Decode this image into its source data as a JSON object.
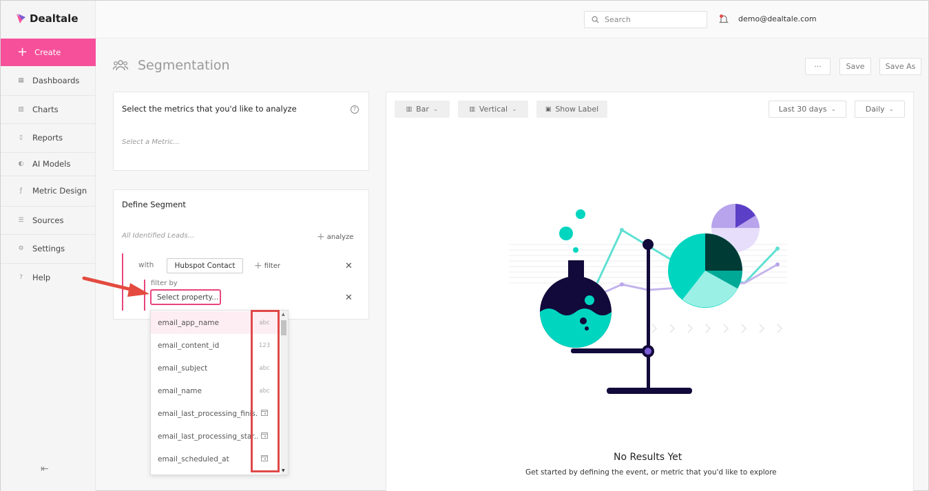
{
  "app": {
    "name": "Dealtale"
  },
  "sidebar": {
    "create_label": "Create",
    "items": [
      {
        "label": "Dashboards",
        "icon": "grid-icon"
      },
      {
        "label": "Charts",
        "icon": "bar-chart-icon"
      },
      {
        "label": "Reports",
        "icon": "document-icon"
      },
      {
        "label": "AI Models",
        "icon": "brain-icon"
      },
      {
        "label": "Metric Design",
        "icon": "function-icon"
      },
      {
        "label": "Sources",
        "icon": "database-icon"
      },
      {
        "label": "Settings",
        "icon": "gear-icon"
      },
      {
        "label": "Help",
        "icon": "question-icon"
      }
    ]
  },
  "topbar": {
    "search_placeholder": "Search",
    "user_email": "demo@dealtale.com"
  },
  "page": {
    "title": "Segmentation",
    "more_label": "···",
    "save_label": "Save",
    "save_as_label": "Save As"
  },
  "metrics_panel": {
    "title": "Select the metrics that you'd like to analyze",
    "placeholder": "Select a Metric..."
  },
  "segment_panel": {
    "title": "Define Segment",
    "leads_label": "All Identified Leads...",
    "analyze_label": "analyze",
    "with_label": "with",
    "contact_button": "Hubspot Contact",
    "filter_label": "filter",
    "filter_by_label": "filter by",
    "select_property": "Select property..."
  },
  "property_dropdown": [
    {
      "name": "email_app_name",
      "type": "abc"
    },
    {
      "name": "email_content_id",
      "type": "123"
    },
    {
      "name": "email_subject",
      "type": "abc"
    },
    {
      "name": "email_name",
      "type": "abc"
    },
    {
      "name": "email_last_processing_finis...",
      "type": "date"
    },
    {
      "name": "email_last_processing_star...",
      "type": "date"
    },
    {
      "name": "email_scheduled_at",
      "type": "date"
    }
  ],
  "chart_toolbar": {
    "chart_type": "Bar",
    "orientation": "Vertical",
    "show_label": "Show Label",
    "date_range": "Last 30 days",
    "interval": "Daily"
  },
  "empty_state": {
    "title": "No Results Yet",
    "subtitle": "Get started by defining the event, or metric that you'd like to explore"
  },
  "colors": {
    "accent": "#f6509a",
    "teal": "#00d5c0",
    "navy": "#120a3a",
    "purple": "#7b5cd6"
  }
}
